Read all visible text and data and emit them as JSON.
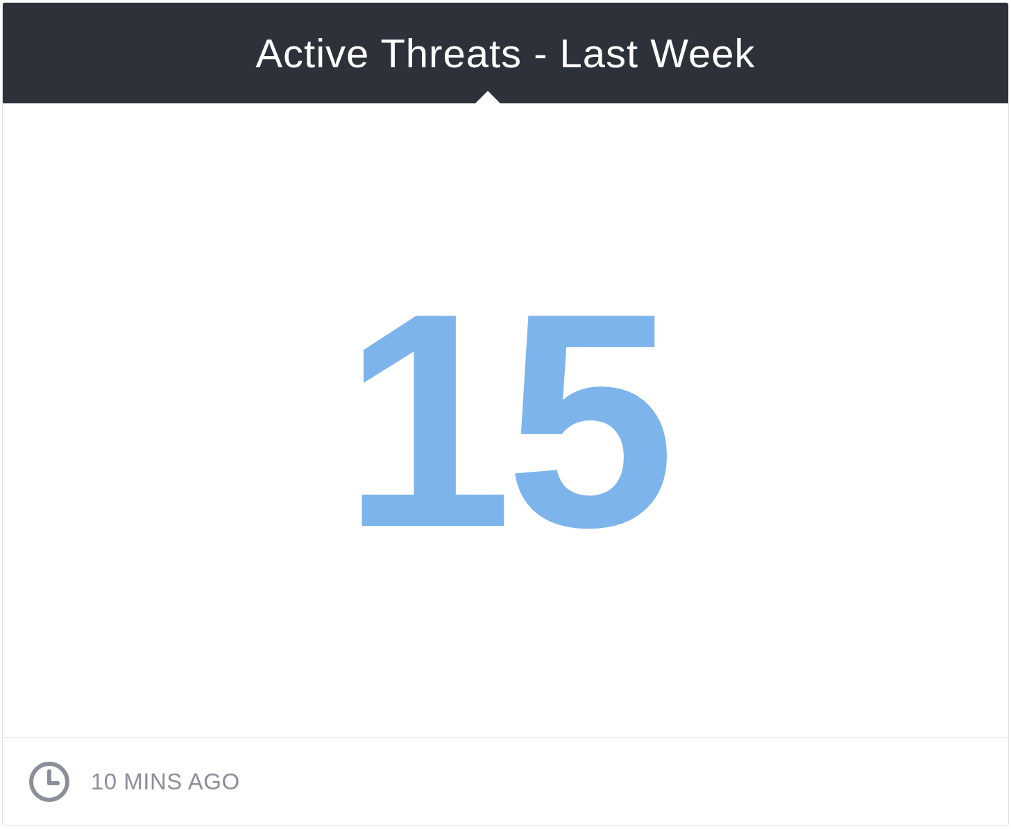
{
  "card": {
    "title": "Active Threats - Last Week",
    "value": "15",
    "updated": "10 MINS AGO"
  }
}
